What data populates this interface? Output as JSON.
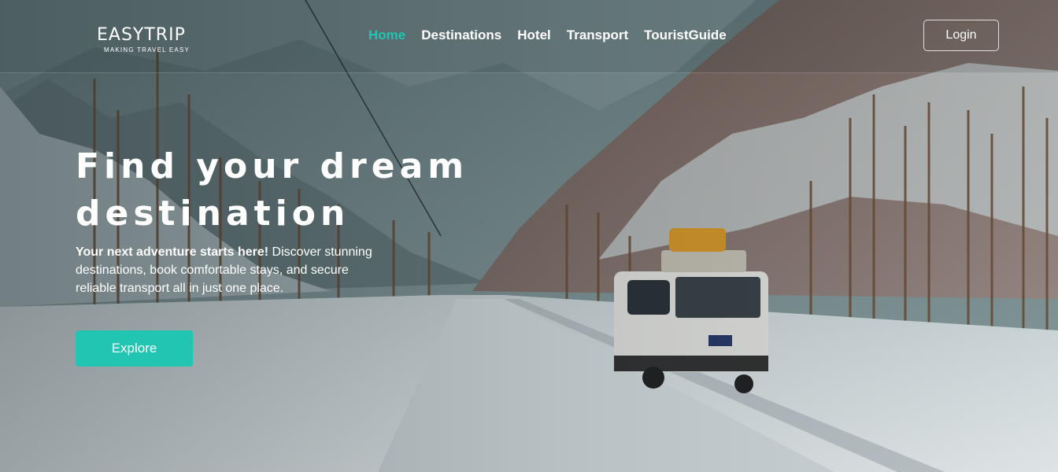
{
  "brand": {
    "name": "EASYTRIP",
    "tagline": "MAKING TRAVEL EASY"
  },
  "nav": {
    "items": [
      {
        "label": "Home",
        "active": true
      },
      {
        "label": "Destinations",
        "active": false
      },
      {
        "label": "Hotel",
        "active": false
      },
      {
        "label": "Transport",
        "active": false
      },
      {
        "label": "TouristGuide",
        "active": false
      }
    ],
    "login_label": "Login"
  },
  "hero": {
    "title_line1": "Find your dream",
    "title_line2": "destination",
    "desc_bold": "Your next adventure starts here!",
    "desc_rest": " Discover stunning destinations, book comfortable stays, and secure reliable transport all in just one place.",
    "button_label": "Explore"
  },
  "colors": {
    "accent": "#22c5b2",
    "text": "#ffffff"
  }
}
